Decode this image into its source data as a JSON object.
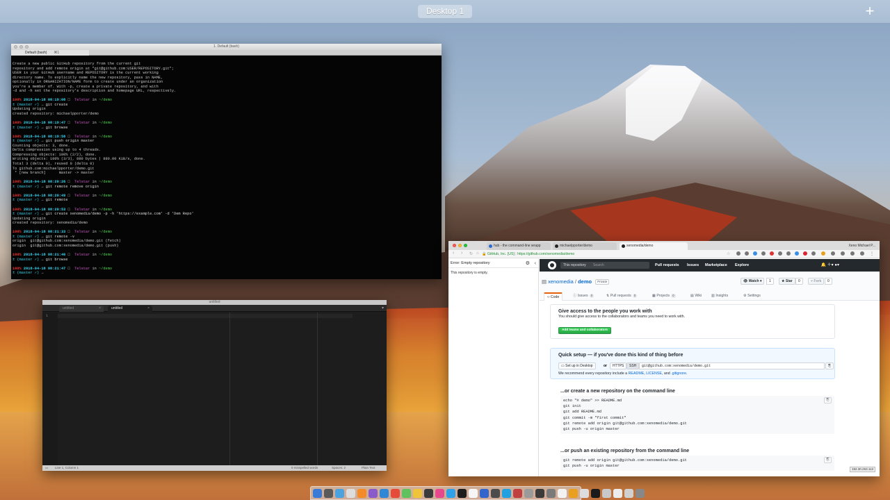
{
  "mission_control": {
    "desktop_label": "Desktop 1",
    "add_space_label": "+"
  },
  "terminal": {
    "title": "1. Default (bash)",
    "tab_label": "Default (bash)",
    "tab_shortcut": "⌘1",
    "help_lines": [
      "Create a new public GitHub repository from the current git",
      "repository and add remote origin at \"git@github.com:USER/REPOSITORY.git\";",
      "USER is your GitHub username and REPOSITORY is the current working",
      "directory name. To explicitly name the new repository, pass in NAME,",
      "optionally in ORGANIZATION/NAME form to create under an organization",
      "you're a member of. With -p, create a private repository, and with",
      "-d and -h set the repository's description and homepage URL, respectively."
    ],
    "blocks": [
      {
        "time": "2018-04-18 08:19:08",
        "cmd": "git create",
        "output": [
          "Updating origin",
          "created repository: michaelpporter/demo"
        ]
      },
      {
        "time": "2018-04-18 08:19:47",
        "cmd": "git browse",
        "output": []
      },
      {
        "time": "2018-04-18 08:19:58",
        "cmd": "git push origin master",
        "output": [
          "Counting objects: 3, done.",
          "Delta compression using up to 4 threads.",
          "Compressing objects: 100% (2/2), done.",
          "Writing objects: 100% (3/3), 880 bytes | 880.00 KiB/s, done.",
          "Total 3 (delta 0), reused 0 (delta 0)",
          "To github.com:michaelpporter/demo.git",
          " * [new branch]      master -> master"
        ]
      },
      {
        "time": "2018-04-18 08:20:26",
        "cmd": "git remote remove origin",
        "output": []
      },
      {
        "time": "2018-04-18 08:20:49",
        "cmd": "git remote",
        "output": []
      },
      {
        "time": "2018-04-18 08:20:53",
        "cmd": "git create xenomedia/demo -p -h 'https://example.com' -d 'Dem Repo'",
        "output": [
          "Updating origin",
          "created repository: xenomedia/demo"
        ]
      },
      {
        "time": "2018-04-18 08:21:33",
        "cmd": "git remote -v",
        "output": [
          "origin  git@github.com:xenomedia/demo.git (fetch)",
          "origin  git@github.com:xenomedia/demo.git (push)"
        ]
      },
      {
        "time": "2018-04-18 08:21:40",
        "cmd": "git browse",
        "output": []
      },
      {
        "time": "2018-04-18 08:21:47",
        "cmd": "",
        "output": []
      }
    ],
    "prompt": {
      "pct": "100%",
      "icon": "□",
      "host": "Telstar",
      "in": "in",
      "path": "~/demo",
      "branch": "(master ✓)",
      "arrow": "→"
    }
  },
  "editor": {
    "title": "untitled",
    "tabs": [
      {
        "label": "untitled"
      },
      {
        "label": "untitled"
      }
    ],
    "line_number": "1",
    "status": {
      "position": "Line 1, Column 1",
      "misspelled": "0 misspelled words",
      "spaces": "Spaces: 2",
      "syntax": "Plain Text"
    }
  },
  "browser": {
    "tabs": [
      {
        "label": "hub - the command-line wrapp"
      },
      {
        "label": "michaelpporter/demo"
      },
      {
        "label": "xenomedia/demo"
      }
    ],
    "profile": "Xeno Michael P...",
    "url_org": "GitHub, Inc. [US]",
    "url": "https://github.com/xenomedia/demo",
    "sidebar": {
      "header": "Error: Empty repository",
      "body": "This repository is empty."
    },
    "github": {
      "scope": "This repository",
      "search_placeholder": "Search",
      "nav": [
        "Pull requests",
        "Issues",
        "Marketplace",
        "Explore"
      ],
      "owner": "xenomedia",
      "repo": "demo",
      "private_label": "Private",
      "watch_label": "Watch",
      "watch_count": "1",
      "star_label": "Star",
      "star_count": "0",
      "fork_label": "Fork",
      "fork_count": "0",
      "tabs": [
        {
          "label": "Code",
          "count": ""
        },
        {
          "label": "Issues",
          "count": "0"
        },
        {
          "label": "Pull requests",
          "count": "0"
        },
        {
          "label": "Projects",
          "count": "0"
        },
        {
          "label": "Wiki",
          "count": ""
        },
        {
          "label": "Insights",
          "count": ""
        },
        {
          "label": "Settings",
          "count": ""
        }
      ],
      "access_title": "Give access to the people you work with",
      "access_text": "You should give access to the collaborators and teams you need to work with.",
      "access_button": "Add teams and collaborators",
      "quick_title": "Quick setup — if you've done this kind of thing before",
      "desktop_button": "Set up in Desktop",
      "or_label": "or",
      "https_label": "HTTPS",
      "ssh_label": "SSH",
      "clone_url": "git@github.com:xenomedia/demo.git",
      "recommend_prefix": "We recommend every repository include a",
      "readme_link": "README",
      "license_link": "LICENSE",
      "and_label": "and",
      "gitignore_link": ".gitignore",
      "create_title": "...or create a new repository on the command line",
      "create_lines": [
        "echo \"# demo\" >> README.md",
        "git init",
        "git add README.md",
        "git commit -m \"first commit\"",
        "git remote add origin git@github.com:xenomedia/demo.git",
        "git push -u origin master"
      ],
      "push_title": "...or push an existing repository from the command line",
      "push_lines": [
        "git remote add origin git@github.com:xenomedia/demo.git",
        "git push -u origin master"
      ]
    },
    "ip_badge": "192.30.253.113"
  },
  "dock": {
    "icon_count": 30
  }
}
